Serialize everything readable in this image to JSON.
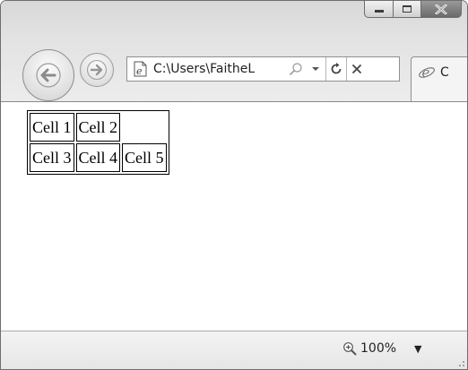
{
  "browser": {
    "address": "C:\\Users\\FaitheL",
    "tab_title": "C",
    "zoom": "100%"
  },
  "table": {
    "rows": [
      [
        "Cell 1",
        "Cell 2"
      ],
      [
        "Cell 3",
        "Cell 4",
        "Cell 5"
      ]
    ]
  },
  "icons": {
    "back": "back-arrow-icon",
    "forward": "forward-arrow-icon",
    "page": "ie-page-icon",
    "search": "search-icon",
    "dropdown": "chevron-down-icon",
    "refresh": "refresh-icon",
    "stop": "stop-icon",
    "zoom": "zoom-icon",
    "minimize": "minimize-icon",
    "maximize": "maximize-icon",
    "close": "close-icon"
  }
}
